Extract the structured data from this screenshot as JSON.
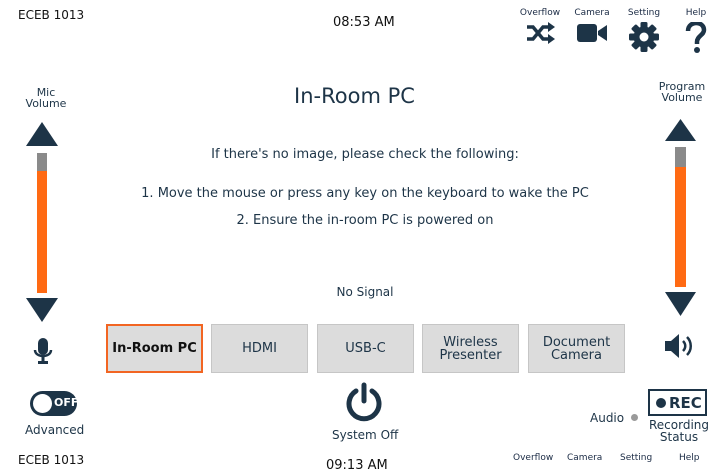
{
  "header": {
    "room": "ECEB 1013",
    "time": "08:53 AM",
    "buttons": [
      {
        "label": "Overflow",
        "icon": "shuffle-icon"
      },
      {
        "label": "Camera",
        "icon": "video-camera-icon"
      },
      {
        "label": "Setting",
        "icon": "gear-icon"
      },
      {
        "label": "Help",
        "icon": "question-mark-icon"
      }
    ]
  },
  "mic": {
    "label_line1": "Mic",
    "label_line2": "Volume",
    "level_percent": 87
  },
  "program": {
    "label_line1": "Program",
    "label_line2": "Volume",
    "level_percent": 86
  },
  "main": {
    "title": "In-Room PC",
    "check_message": "If there's no image, please check the following:",
    "step1": "1. Move the mouse or press any key on the keyboard to wake the PC",
    "step2": "2. Ensure the in-room PC is powered on",
    "signal_status": "No Signal"
  },
  "sources": [
    {
      "line1": "In-Room PC",
      "line2": "",
      "active": true
    },
    {
      "line1": "HDMI",
      "line2": "",
      "active": false
    },
    {
      "line1": "USB-C",
      "line2": "",
      "active": false
    },
    {
      "line1": "Wireless",
      "line2": "Presenter",
      "active": false
    },
    {
      "line1": "Document",
      "line2": "Camera",
      "active": false
    }
  ],
  "footer": {
    "advanced_toggle_state": "OFF",
    "advanced_label": "Advanced",
    "system_off_label": "System Off",
    "audio_label": "Audio",
    "rec_label": "REC",
    "recording_status_line1": "Recording",
    "recording_status_line2": "Status"
  },
  "duplicate_strip": {
    "room": "ECEB 1013",
    "time": "09:13 AM",
    "labels": [
      "Overflow",
      "Camera",
      "Setting",
      "Help"
    ]
  },
  "colors": {
    "accent": "#ff6a13",
    "navy": "#1d3447",
    "button_bg": "#dcdcdc",
    "track": "#8a8a8a"
  }
}
